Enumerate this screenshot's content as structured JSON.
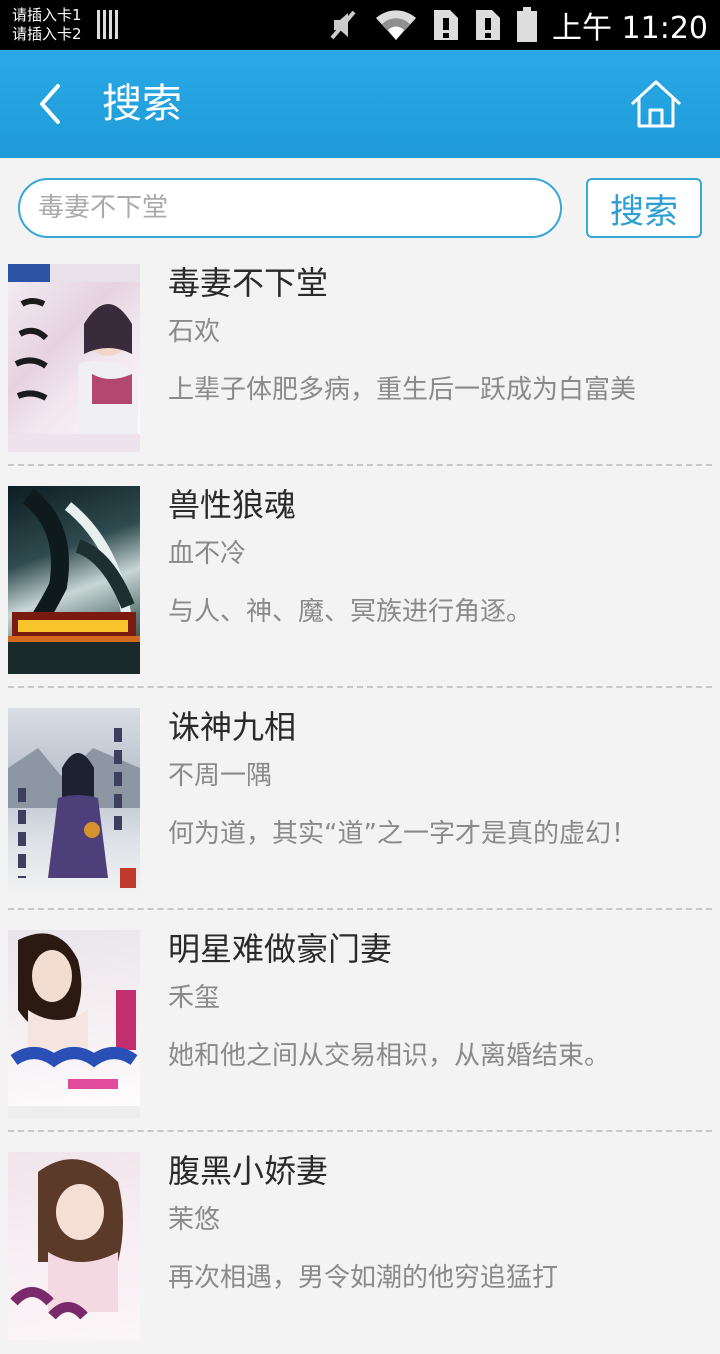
{
  "status_bar": {
    "sim1": "请插入卡1",
    "sim2": "请插入卡2",
    "time": "上午 11:20",
    "icons": [
      "signal-bars-icon",
      "mute-icon",
      "wifi-icon",
      "sim-alert-icon",
      "sim-alert-icon",
      "battery-icon"
    ]
  },
  "header": {
    "title": "搜索",
    "back_icon": "back-chevron-icon",
    "home_icon": "home-icon"
  },
  "search": {
    "placeholder": "毒妻不下堂",
    "button_label": "搜索"
  },
  "results": [
    {
      "title": "毒妻不下堂",
      "author": "石欢",
      "desc": "上辈子体肥多病，重生后一跃成为白富美"
    },
    {
      "title": "兽性狼魂",
      "author": "血不冷",
      "desc": "与人、神、魔、冥族进行角逐。"
    },
    {
      "title": "诛神九相",
      "author": "不周一隅",
      "desc": "何为道，其实“道”之一字才是真的虚幻！"
    },
    {
      "title": "明星难做豪门妻",
      "author": "禾玺",
      "desc": "她和他之间从交易相识，从离婚结束。"
    },
    {
      "title": "腹黑小娇妻",
      "author": "茉悠",
      "desc": "再次相遇，男令如潮的他穷追猛打"
    }
  ]
}
